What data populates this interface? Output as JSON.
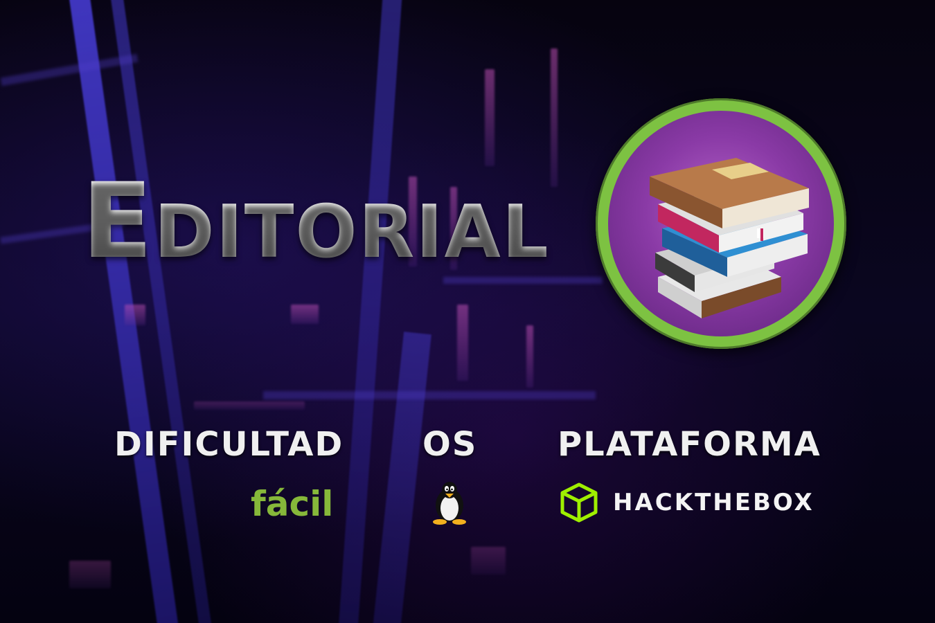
{
  "title": "Editorial",
  "labels": {
    "difficulty": "DIFICULTAD",
    "os": "OS",
    "platform": "PLATAFORMA"
  },
  "values": {
    "difficulty": "fácil",
    "platform": "HACKTHEBOX"
  },
  "icons": {
    "badge": "book-stack-icon",
    "os": "linux-penguin-icon",
    "platform": "hackthebox-cube-icon"
  },
  "colors": {
    "badge_ring": "#7dc242",
    "badge_fill": "#8a3aa6",
    "difficulty": "#86b83a",
    "htb_green": "#9fef00",
    "background_accent": "#3c2fb8"
  }
}
